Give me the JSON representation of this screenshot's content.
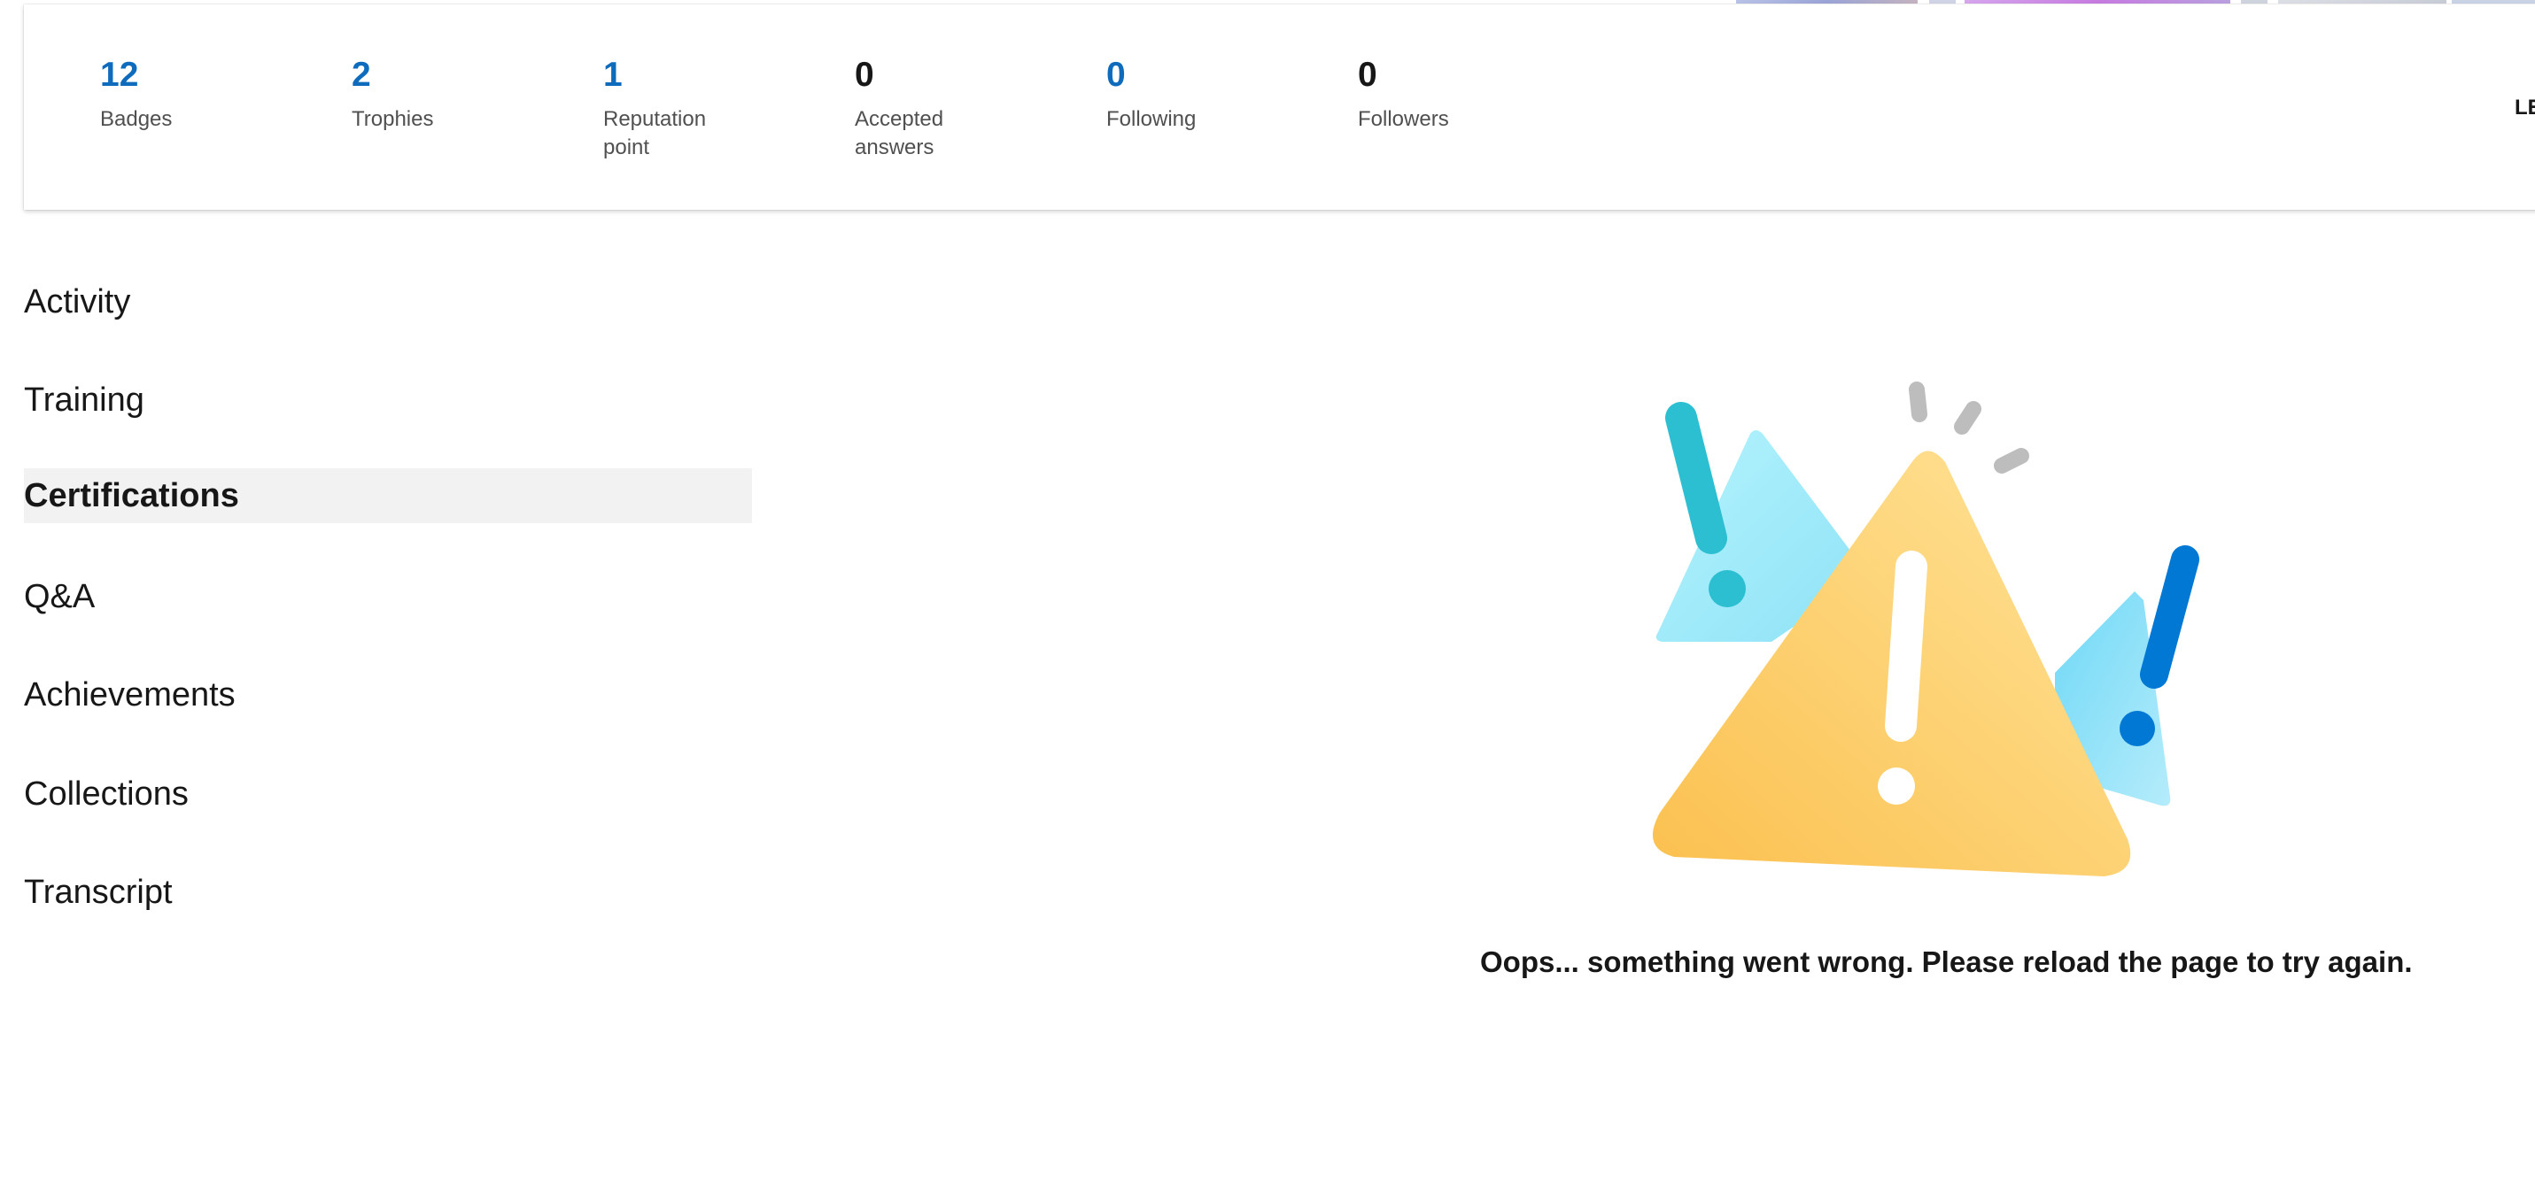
{
  "stats": [
    {
      "value": "12",
      "label": "Badges",
      "color": "#0f6cbd"
    },
    {
      "value": "2",
      "label": "Trophies",
      "color": "#0f6cbd"
    },
    {
      "value": "1",
      "label": "Reputation point",
      "color": "#0f6cbd"
    },
    {
      "value": "0",
      "label": "Accepted answers",
      "color": "#171717"
    },
    {
      "value": "0",
      "label": "Following",
      "color": "#0f6cbd"
    },
    {
      "value": "0",
      "label": "Followers",
      "color": "#171717"
    }
  ],
  "edge_text": "LE",
  "nav": {
    "items": [
      {
        "label": "Activity"
      },
      {
        "label": "Training"
      },
      {
        "label": "Certifications",
        "active": true
      },
      {
        "label": "Q&A"
      },
      {
        "label": "Achievements"
      },
      {
        "label": "Collections"
      },
      {
        "label": "Transcript"
      }
    ]
  },
  "error": {
    "message": "Oops... something went wrong. Please reload the page to try again.",
    "icon": "warning-icon"
  },
  "colors": {
    "accent": "#0f6cbd",
    "active_bg": "#f2f2f2",
    "warning_yellow": "#fcc653",
    "light_blue": "#a6f0fc",
    "teal": "#2cbfd2",
    "blue": "#0078d4"
  }
}
